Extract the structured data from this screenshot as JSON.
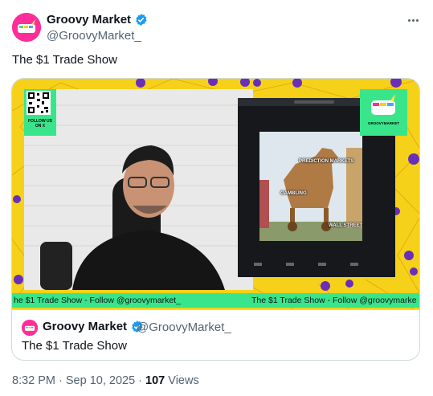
{
  "author": {
    "name": "Groovy Market",
    "handle": "@GroovyMarket_",
    "avatar_icon": "unicorn-logo-icon",
    "verified_icon": "verified-badge-icon"
  },
  "menu": {
    "more_icon": "more-options-icon"
  },
  "tweet": {
    "text": "The $1 Trade Show"
  },
  "media": {
    "follow_label": "FOLLOW US ON X",
    "logo_label": "GROOVYMARKET",
    "meme_labels": [
      "PREDICTION MARKETS",
      "GAMBLING",
      "WALL STREET"
    ],
    "ticker_left": "he $1 Trade Show - Follow @groovymarket_",
    "ticker_right": "The $1 Trade Show - Follow @groovymarke"
  },
  "quote": {
    "name": "Groovy Market",
    "handle": "@GroovyMarket_",
    "text": "The $1 Trade Show"
  },
  "meta": {
    "time": "8:32 PM · Sep 10, 2025 · ",
    "views_count": "107",
    "views_label": " Views"
  },
  "colors": {
    "brand_pink": "#ff2d9a",
    "banner_yellow": "#f6d11a",
    "accent_green": "#39e58a",
    "verified_blue": "#1d9bf0"
  }
}
